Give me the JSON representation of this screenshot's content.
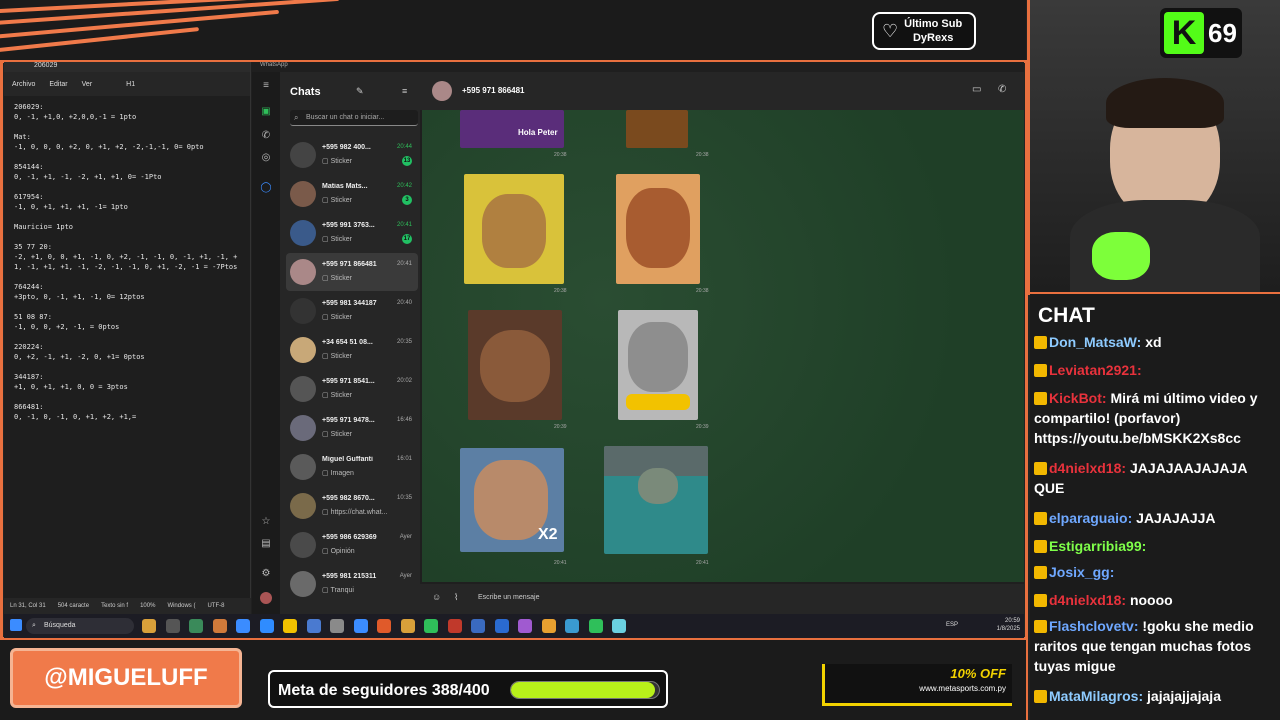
{
  "overlay": {
    "last_sub_label": "Último Sub",
    "last_sub_name": "DyRexs",
    "kick_logo": "K",
    "viewer_count": "69",
    "handle": "@MIGUELUFF",
    "goal_text": "Meta de seguidores 388/400",
    "goal_progress": 0.97,
    "ad_offer": "10% OFF",
    "ad_url": "www.metasports.com.py",
    "chat_title": "CHAT",
    "accent_color": "#e9703f",
    "kick_green": "#53fc18"
  },
  "notepad": {
    "tab_title": "206029",
    "menu": [
      "Archivo",
      "Editar",
      "Ver",
      "H1"
    ],
    "content": "206029:\n0, -1, +1,0, +2,0,0,-1 = 1pto\n\nMat:\n-1, 0, 0, 0, +2, 0, +1, +2, -2,-1,-1, 0= 0pto\n\n854144:\n0, -1, +1, -1, -2, +1, +1, 0= -1Pto\n\n617954:\n-1, 0, +1, +1, +1, -1= 1pto\n\nMauricio= 1pto\n\n35 77 20:\n-2, +1, 0, 0, +1, -1, 0, +2, -1, -1, 0, -1, +1, -1, +\n1, -1, +1, +1, -1, -2, -1, -1, 0, +1, -2, -1 = -7Ptos\n\n764244:\n+3pto, 0, -1, +1, -1, 0= 12ptos\n\n51 08 87:\n-1, 0, 0, +2, -1, = 0ptos\n\n220224:\n0, +2, -1, +1, -2, 0, +1= 0ptos\n\n344187:\n+1, 0, +1, +1, 0, 0 = 3ptos\n\n866481:\n0, -1, 0, -1, 0, +1, +2, +1,=",
    "status": [
      "Ln 31, Col 31",
      "504 caracte",
      "Texto sin f",
      "100%",
      "Windows (",
      "UTF-8"
    ]
  },
  "whatsapp": {
    "app_title": "WhatsApp",
    "list_title": "Chats",
    "search_placeholder": "Buscar un chat o iniciar...",
    "chats": [
      {
        "name": "+595 982 400...",
        "preview": "Sticker",
        "time": "20:44",
        "badge": "13",
        "active": false
      },
      {
        "name": "Matias Mats...",
        "preview": "Sticker",
        "time": "20:42",
        "badge": "3",
        "active": false
      },
      {
        "name": "+595 991 3763...",
        "preview": "Sticker",
        "time": "20:41",
        "badge": "17",
        "active": false
      },
      {
        "name": "+595 971 866481",
        "preview": "Sticker",
        "time": "20:41",
        "badge": "",
        "active": true
      },
      {
        "name": "+595 981 344187",
        "preview": "Sticker",
        "time": "20:40",
        "badge": "",
        "active": false
      },
      {
        "name": "+34 654 51 08...",
        "preview": "Sticker",
        "time": "20:35",
        "badge": "",
        "active": false
      },
      {
        "name": "+595 971 8541...",
        "preview": "Sticker",
        "time": "20:02",
        "badge": "",
        "active": false
      },
      {
        "name": "+595 971 9478...",
        "preview": "Sticker",
        "time": "16:46",
        "badge": "",
        "active": false
      },
      {
        "name": "Miguel Guffanti",
        "preview": "Imagen",
        "time": "16:01",
        "badge": "",
        "active": false
      },
      {
        "name": "+595 982 8670...",
        "preview": "https://chat.what...",
        "time": "10:35",
        "badge": "",
        "active": false
      },
      {
        "name": "+595 986 629369",
        "preview": "Opinión",
        "time": "Ayer",
        "badge": "",
        "active": false
      },
      {
        "name": "+595 981 215311",
        "preview": "Tranqui",
        "time": "Ayer",
        "badge": "",
        "active": false
      }
    ],
    "header_name": "+595 971 866481",
    "sticker_caption_1": "Hola Peter",
    "sticker_caption_2": "X2",
    "sticker_times": [
      "20:38",
      "20:38",
      "20:38",
      "20:38",
      "20:39",
      "20:39",
      "20:41",
      "20:41"
    ],
    "compose_placeholder": "Escribe un mensaje"
  },
  "taskbar": {
    "search_label": "Búsqueda",
    "lang": "ESP",
    "time": "20:59",
    "date": "1/8/2025"
  },
  "chat": [
    {
      "user": "Don_MatsaW",
      "color": "#8ecbff",
      "text": "xd"
    },
    {
      "user": "Leviatan2921",
      "color": "#e8323c",
      "text": ""
    },
    {
      "user": "KickBot",
      "color": "#e8323c",
      "text": "Mirá mi último video y compartilo! (porfavor) https://youtu.be/bMSKK2Xs8cc"
    },
    {
      "user": "d4nielxd18",
      "color": "#e8323c",
      "text": "JAJAJAAJAJAJA QUE"
    },
    {
      "user": "elparaguaio",
      "color": "#6fa8ff",
      "text": "JAJAJAJJA"
    },
    {
      "user": "Estigarribia99",
      "color": "#7fff4a",
      "text": ""
    },
    {
      "user": "Josix_gg",
      "color": "#6fa8ff",
      "text": ""
    },
    {
      "user": "d4nielxd18",
      "color": "#e8323c",
      "text": "noooo"
    },
    {
      "user": "Flashclovetv",
      "color": "#6fa8ff",
      "text": "!goku she medio raritos que tengan muchas fotos tuyas migue"
    },
    {
      "user": "MataMilagros",
      "color": "#8ecbff",
      "text": "jajajajjajaja"
    }
  ]
}
